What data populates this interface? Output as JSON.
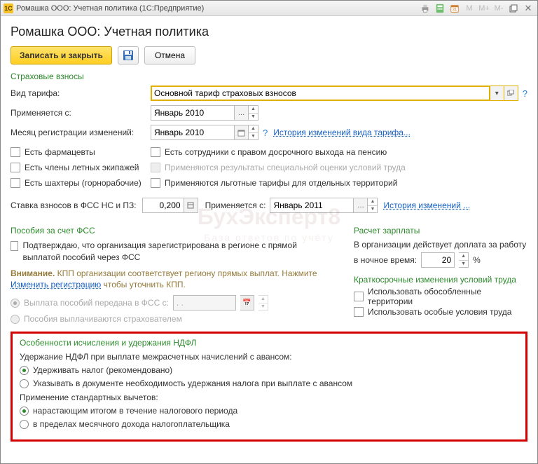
{
  "window": {
    "title": "Ромашка ООО: Учетная политика  (1С:Предприятие)",
    "tb_chars": {
      "m": "M",
      "mplus": "M+",
      "mminus": "M-"
    }
  },
  "page_title": "Ромашка ООО: Учетная политика",
  "toolbar": {
    "save_close": "Записать и закрыть",
    "cancel": "Отмена"
  },
  "insurance": {
    "section": "Страховые взносы",
    "tariff_label": "Вид тарифа:",
    "tariff_value": "Основной тариф страховых взносов",
    "applies_from_label": "Применяется с:",
    "applies_from_value": "Январь 2010",
    "reg_month_label": "Месяц регистрации изменений:",
    "reg_month_value": "Январь 2010",
    "history_link": "История изменений вида тарифа...",
    "checkboxes": {
      "pharm": "Есть фармацевты",
      "flight": "Есть члены летных экипажей",
      "miners": "Есть шахтеры (горнорабочие)",
      "early_pension": "Есть сотрудники с правом досрочного выхода на пенсию",
      "special_eval": "Применяются результаты специальной оценки условий труда",
      "pref_tariffs": "Применяются льготные тарифы для отдельных территорий"
    },
    "fss_rate_label": "Ставка взносов в ФСС НС и ПЗ:",
    "fss_rate_value": "0,200",
    "fss_applies_label": "Применяется с:",
    "fss_applies_value": "Январь 2011",
    "fss_history": "История изменений ..."
  },
  "fss_benefits": {
    "section": "Пособия за счет ФСС",
    "confirm": "Подтверждаю, что организация зарегистрирована в регионе с прямой выплатой пособий через ФСС",
    "warn_prefix": "Внимание.",
    "warn_text": " КПП организации соответствует региону прямых выплат. Нажмите ",
    "warn_link": "Изменить регистрацию",
    "warn_suffix": " чтобы уточнить КПП.",
    "radio_transferred": "Выплата пособий передана в ФСС с:",
    "radio_transferred_date": ". .",
    "radio_insurer": "Пособия выплачиваются страхователем"
  },
  "salary": {
    "section": "Расчет зарплаты",
    "night_text1": "В организации действует доплата за работу",
    "night_text2": "в ночное время:",
    "night_value": "20",
    "night_pct": "%"
  },
  "labor": {
    "section": "Краткосрочные изменения условий труда",
    "chk_isolated": "Использовать обособленные территории",
    "chk_special": "Использовать особые условия труда"
  },
  "ndfl": {
    "section": "Особенности исчисления и удержания НДФЛ",
    "withhold_label": "Удержание НДФЛ при выплате межрасчетных начислений с авансом:",
    "opt_withhold": "Удерживать налог (рекомендовано)",
    "opt_indicate": "Указывать в документе необходимость удержания налога при выплате с авансом",
    "deduct_label": "Применение стандартных вычетов:",
    "opt_cumulative": "нарастающим итогом в течение налогового периода",
    "opt_monthly": "в пределах месячного дохода налогоплательщика"
  },
  "watermark": {
    "main": "БухЭксперт8",
    "sub": "База ответов по учёту"
  },
  "help": "?"
}
